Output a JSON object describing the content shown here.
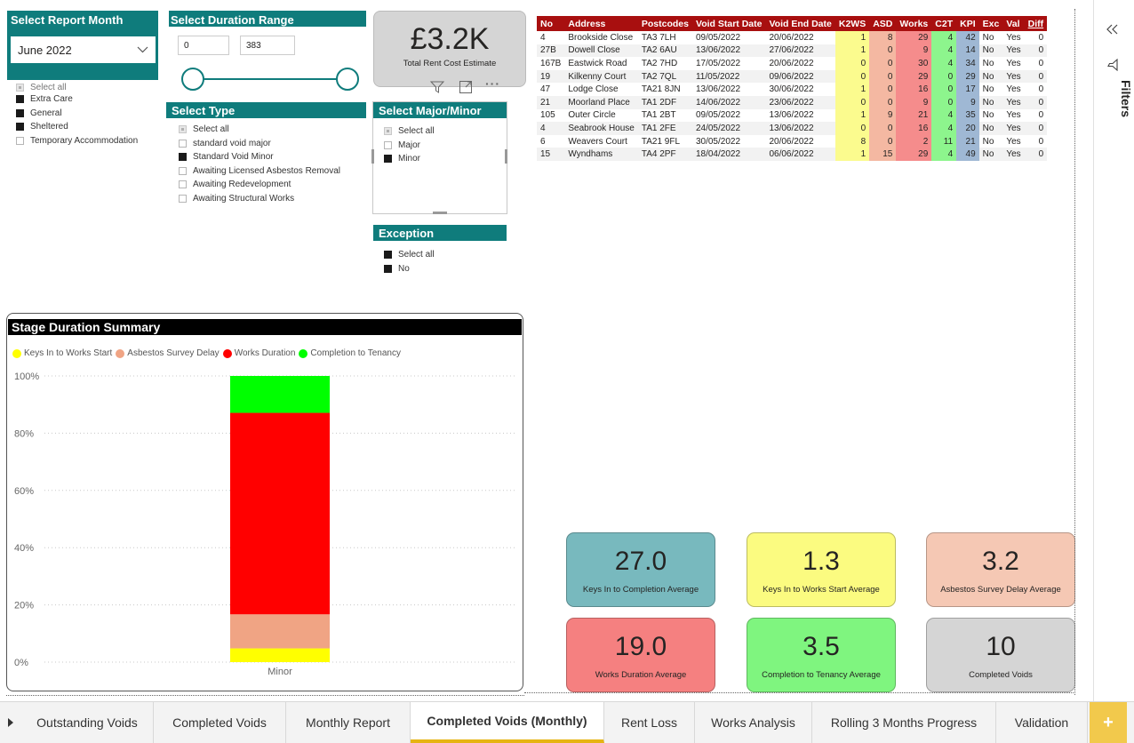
{
  "report_month": {
    "title": "Select Report Month",
    "selected": "June 2022"
  },
  "month_list": [
    {
      "label": "Select all",
      "state": "partial"
    },
    {
      "label": "Extra Care",
      "state": "on"
    },
    {
      "label": "General",
      "state": "on"
    },
    {
      "label": "Sheltered",
      "state": "on"
    },
    {
      "label": "Temporary Accommodation",
      "state": "off"
    }
  ],
  "duration_range": {
    "title": "Select Duration Range",
    "min": "0",
    "max": "383"
  },
  "select_type": {
    "title": "Select Type",
    "items": [
      {
        "label": "Select all",
        "state": "partial"
      },
      {
        "label": "standard void major",
        "state": "off"
      },
      {
        "label": "Standard Void Minor",
        "state": "on"
      },
      {
        "label": "Awaiting Licensed Asbestos Removal",
        "state": "off"
      },
      {
        "label": "Awaiting Redevelopment",
        "state": "off"
      },
      {
        "label": "Awaiting Structural Works",
        "state": "off"
      }
    ]
  },
  "rent_card": {
    "value": "£3.2K",
    "label": "Total Rent Cost Estimate"
  },
  "major_minor": {
    "title": "Select Major/Minor",
    "items": [
      {
        "label": "Select all",
        "state": "partial"
      },
      {
        "label": "Major",
        "state": "off"
      },
      {
        "label": "Minor",
        "state": "on"
      }
    ]
  },
  "exception": {
    "title": "Exception",
    "items": [
      {
        "label": "Select all",
        "state": "on"
      },
      {
        "label": "No",
        "state": "on"
      }
    ]
  },
  "table": {
    "headers": [
      "No",
      "Address",
      "Postcodes",
      "Void Start Date",
      "Void End Date",
      "K2WS",
      "ASD",
      "Works",
      "C2T",
      "KPI",
      "Exc",
      "Val",
      "Diff"
    ],
    "rows": [
      [
        "4",
        "Brookside Close",
        "TA3 7LH",
        "09/05/2022",
        "20/06/2022",
        "1",
        "8",
        "29",
        "4",
        "42",
        "No",
        "Yes",
        "0"
      ],
      [
        "27B",
        "Dowell Close",
        "TA2 6AU",
        "13/06/2022",
        "27/06/2022",
        "1",
        "0",
        "9",
        "4",
        "14",
        "No",
        "Yes",
        "0"
      ],
      [
        "167B",
        "Eastwick Road",
        "TA2 7HD",
        "17/05/2022",
        "20/06/2022",
        "0",
        "0",
        "30",
        "4",
        "34",
        "No",
        "Yes",
        "0"
      ],
      [
        "19",
        "Kilkenny Court",
        "TA2 7QL",
        "11/05/2022",
        "09/06/2022",
        "0",
        "0",
        "29",
        "0",
        "29",
        "No",
        "Yes",
        "0"
      ],
      [
        "47",
        "Lodge Close",
        "TA21 8JN",
        "13/06/2022",
        "30/06/2022",
        "1",
        "0",
        "16",
        "0",
        "17",
        "No",
        "Yes",
        "0"
      ],
      [
        "21",
        "Moorland Place",
        "TA1 2DF",
        "14/06/2022",
        "23/06/2022",
        "0",
        "0",
        "9",
        "0",
        "9",
        "No",
        "Yes",
        "0"
      ],
      [
        "105",
        "Outer Circle",
        "TA1 2BT",
        "09/05/2022",
        "13/06/2022",
        "1",
        "9",
        "21",
        "4",
        "35",
        "No",
        "Yes",
        "0"
      ],
      [
        "4",
        "Seabrook House",
        "TA1 2FE",
        "24/05/2022",
        "13/06/2022",
        "0",
        "0",
        "16",
        "4",
        "20",
        "No",
        "Yes",
        "0"
      ],
      [
        "6",
        "Weavers Court",
        "TA21 9FL",
        "30/05/2022",
        "20/06/2022",
        "8",
        "0",
        "2",
        "11",
        "21",
        "No",
        "Yes",
        "0"
      ],
      [
        "15",
        "Wyndhams",
        "TA4 2PF",
        "18/04/2022",
        "06/06/2022",
        "1",
        "15",
        "29",
        "4",
        "49",
        "No",
        "Yes",
        "0"
      ]
    ]
  },
  "chart_data": {
    "type": "bar",
    "title": "Stage Duration Summary",
    "stacked": "100%",
    "categories": [
      "Minor"
    ],
    "series": [
      {
        "name": "Keys In to Works Start",
        "color": "#ffff00",
        "values": [
          4.8
        ]
      },
      {
        "name": "Asbestos Survey Delay",
        "color": "#f0a484",
        "values": [
          11.9
        ]
      },
      {
        "name": "Works Duration",
        "color": "#ff0000",
        "values": [
          70.4
        ]
      },
      {
        "name": "Completion to Tenancy",
        "color": "#00ff00",
        "values": [
          12.9
        ]
      }
    ],
    "y_ticks": [
      "100%",
      "80%",
      "60%",
      "40%",
      "20%",
      "0%"
    ],
    "ylim": [
      0,
      100
    ],
    "grid": true,
    "legend": "top-left"
  },
  "kpis": [
    {
      "value": "27.0",
      "label": "Keys In to Completion Average",
      "color": "#78b9be"
    },
    {
      "value": "1.3",
      "label": "Keys In to Works Start Average",
      "color": "#fbfb80"
    },
    {
      "value": "3.2",
      "label": "Asbestos Survey Delay Average",
      "color": "#f5c8b4"
    },
    {
      "value": "19.0",
      "label": "Works Duration Average",
      "color": "#f58080"
    },
    {
      "value": "3.5",
      "label": "Completion to Tenancy Average",
      "color": "#7ff57f"
    },
    {
      "value": "10",
      "label": "Completed Voids",
      "color": "#d5d5d5"
    }
  ],
  "filters_pane": {
    "label": "Filters"
  },
  "tabs": [
    {
      "label": "Outstanding Voids",
      "active": false
    },
    {
      "label": "Completed Voids",
      "active": false
    },
    {
      "label": "Monthly Report",
      "active": false
    },
    {
      "label": "Completed Voids (Monthly)",
      "active": true
    },
    {
      "label": "Rent Loss",
      "active": false
    },
    {
      "label": "Works Analysis",
      "active": false
    },
    {
      "label": "Rolling 3 Months Progress",
      "active": false
    },
    {
      "label": "Validation",
      "active": false
    }
  ],
  "icons": {
    "filter": "filter-icon",
    "focus": "focus-mode-icon",
    "more": "more-options-icon",
    "collapse": "double-chevron-left-icon",
    "add_page": "plus-icon",
    "nav": "play-arrow-icon"
  }
}
